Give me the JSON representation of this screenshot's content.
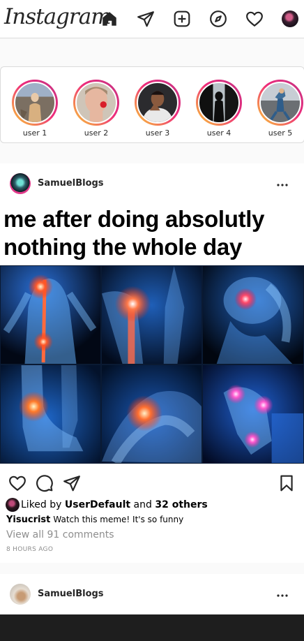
{
  "app": {
    "logo": "Instagram"
  },
  "nav": {
    "icons": [
      "home-icon",
      "direct-send-icon",
      "new-post-icon",
      "explore-compass-icon",
      "activity-heart-icon",
      "profile-avatar"
    ]
  },
  "stories": [
    {
      "label": "user 1"
    },
    {
      "label": "user 2"
    },
    {
      "label": "user 3"
    },
    {
      "label": "user 4"
    },
    {
      "label": "user 5"
    }
  ],
  "posts": [
    {
      "username": "SamuelBlogs",
      "meme_caption_line1": "me after doing absolutly",
      "meme_caption_line2": "nothing the whole day",
      "likes_prefix": "Liked by",
      "likes_user": "UserDefault",
      "likes_middle": "and",
      "likes_others": "32 others",
      "caption_user": "Yisucrist",
      "caption_text": "Watch this meme! It's so funny",
      "view_comments": "View all 91 comments",
      "time_ago": "8 HOURS AGO"
    },
    {
      "username": "SamuelBlogs"
    }
  ],
  "colors": {
    "story_ring_start": "#f9ce34",
    "story_ring_mid": "#ee2a7b",
    "story_ring_end": "#c13584",
    "muted_text": "#8e8e8e",
    "border": "#dbdbdb"
  }
}
